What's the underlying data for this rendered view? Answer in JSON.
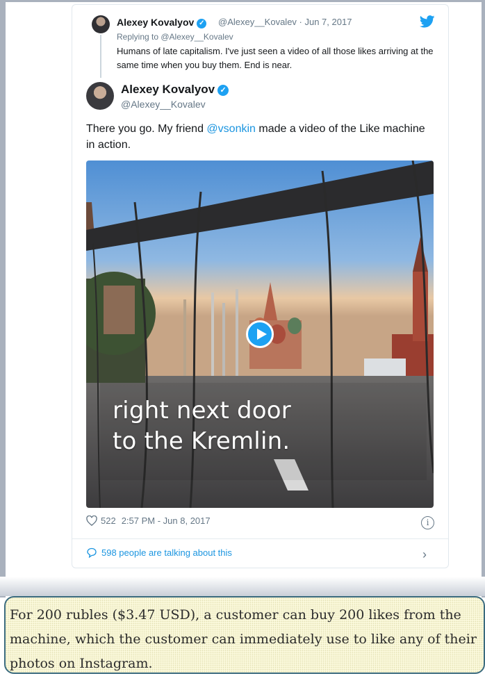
{
  "reply_tweet": {
    "name": "Alexey Kovalyov",
    "handle_date": "@Alexey__Kovalev · Jun 7, 2017",
    "replying_prefix": "Replying to ",
    "replying_to": "@Alexey__Kovalev",
    "text": "Humans of late capitalism. I've just seen a video of all those likes arriving at the same time when you buy them. End is near."
  },
  "main_tweet": {
    "name": "Alexey Kovalyov",
    "handle": "@Alexey__Kovalev",
    "text_before": "There you go. My friend ",
    "mention": "@vsonkin",
    "text_after": " made a video of the Like machine in action.",
    "video_caption_line1": "right next door",
    "video_caption_line2": "to the Kremlin.",
    "likes": "522",
    "timestamp": "2:57 PM - Jun 8, 2017",
    "talking": "598 people are talking about this"
  },
  "quote": {
    "text": "For 200 rubles ($3.47 USD), a customer can buy 200 likes from the machine, which the customer can immediately use to like any of their photos on Instagram."
  },
  "icons": {
    "verified": "verified-badge-icon",
    "bird": "twitter-bird-icon",
    "heart": "heart-icon",
    "info": "info-icon",
    "bubble": "speech-bubble-icon",
    "chevron": "chevron-right-icon",
    "play": "play-icon"
  },
  "colors": {
    "link": "#1b95e0",
    "muted": "#657786",
    "twitter_blue": "#1da1f2",
    "quote_bg": "#fbf9dc",
    "quote_border": "#3b6b7e"
  }
}
